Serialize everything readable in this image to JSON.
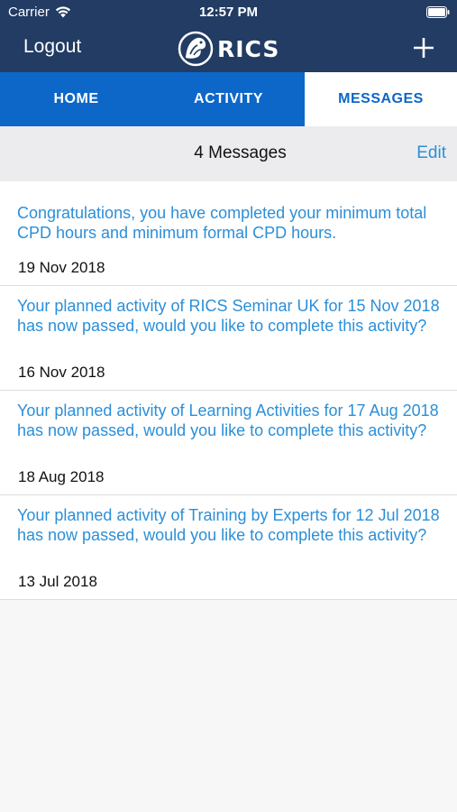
{
  "status_bar": {
    "carrier": "Carrier",
    "time": "12:57 PM",
    "icons": [
      "wifi-icon",
      "battery-icon"
    ]
  },
  "nav": {
    "logout_label": "Logout",
    "logo_text": "RICS",
    "add_icon": "plus-icon"
  },
  "tabs": [
    {
      "label": "HOME",
      "active": false
    },
    {
      "label": "ACTIVITY",
      "active": false
    },
    {
      "label": "MESSAGES",
      "active": true
    }
  ],
  "messages_header": {
    "title": "4 Messages",
    "edit_label": "Edit"
  },
  "messages": [
    {
      "text": "Congratulations, you have completed your minimum total CPD hours and minimum formal CPD hours.",
      "date": "19 Nov 2018"
    },
    {
      "text": "Your planned activity of RICS Seminar UK for 15 Nov 2018 has now passed, would you like to complete this activity?",
      "date": "16 Nov 2018"
    },
    {
      "text": "Your planned activity of Learning Activities for 17 Aug 2018 has now passed, would you like to complete this activity?",
      "date": "18 Aug 2018"
    },
    {
      "text": "Your planned activity of Training by Experts for 12 Jul 2018 has now passed, would you like to complete this activity?",
      "date": "13 Jul 2018"
    }
  ],
  "colors": {
    "nav_background": "#223c63",
    "tab_background": "#0c67c9",
    "link_blue": "#2b8fd8",
    "sub_header_background": "#ececef"
  }
}
